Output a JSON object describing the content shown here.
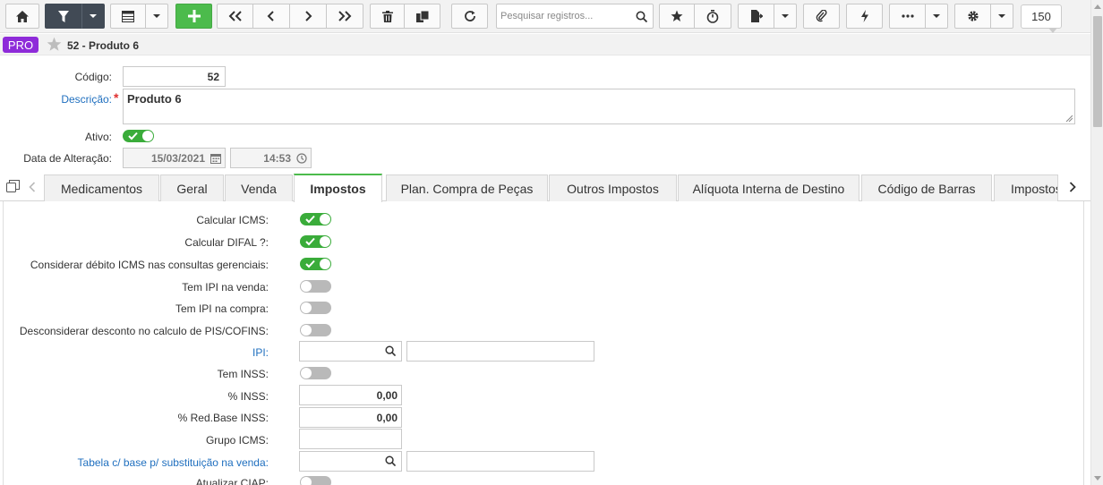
{
  "toolbar": {
    "search_placeholder": "Pesquisar registros...",
    "record_count": "150"
  },
  "header": {
    "badge": "PRO",
    "title": "52 - Produto 6"
  },
  "form": {
    "codigo_label": "Código:",
    "codigo_value": "52",
    "descricao_label": "Descrição:",
    "descricao_required": "*",
    "descricao_value": "Produto 6",
    "ativo_label": "Ativo:",
    "ativo_on": true,
    "data_alteracao_label": "Data de Alteração:",
    "data_alteracao_date": "15/03/2021",
    "data_alteracao_time": "14:53"
  },
  "tabs": [
    {
      "label": "Medicamentos"
    },
    {
      "label": "Geral"
    },
    {
      "label": "Venda"
    },
    {
      "label": "Impostos"
    },
    {
      "label": "Plan. Compra de Peças"
    },
    {
      "label": "Outros Impostos"
    },
    {
      "label": "Alíquota Interna de Destino"
    },
    {
      "label": "Código de Barras"
    },
    {
      "label": "Impostos"
    }
  ],
  "active_tab": "Impostos",
  "impostos": {
    "calcular_icms_label": "Calcular ICMS:",
    "calcular_icms": true,
    "calcular_difal_label": "Calcular DIFAL ?:",
    "calcular_difal": true,
    "considerar_debito_label": "Considerar débito ICMS nas consultas gerenciais:",
    "considerar_debito": true,
    "tem_ipi_venda_label": "Tem IPI na venda:",
    "tem_ipi_venda": false,
    "tem_ipi_compra_label": "Tem IPI na compra:",
    "tem_ipi_compra": false,
    "desconsiderar_desconto_label": "Desconsiderar desconto no calculo de PIS/COFINS:",
    "desconsiderar_desconto": false,
    "ipi_label": "IPI:",
    "tem_inss_label": "Tem INSS:",
    "tem_inss": false,
    "pct_inss_label": "% INSS:",
    "pct_inss_value": "0,00",
    "pct_red_base_inss_label": "% Red.Base INSS:",
    "pct_red_base_inss_value": "0,00",
    "grupo_icms_label": "Grupo ICMS:",
    "tabela_base_label": "Tabela c/ base p/ substituição na venda:",
    "atualizar_ciap_label": "Atualizar CIAP:",
    "atualizar_ciap": false
  },
  "colors": {
    "accent_green": "#4cbb4c",
    "toggle_on": "#3aac3a",
    "toggle_off": "#b9b9b9",
    "badge": "#8e2bd9",
    "link_blue": "#1f6fbf",
    "toolbar_dark": "#414a55"
  }
}
